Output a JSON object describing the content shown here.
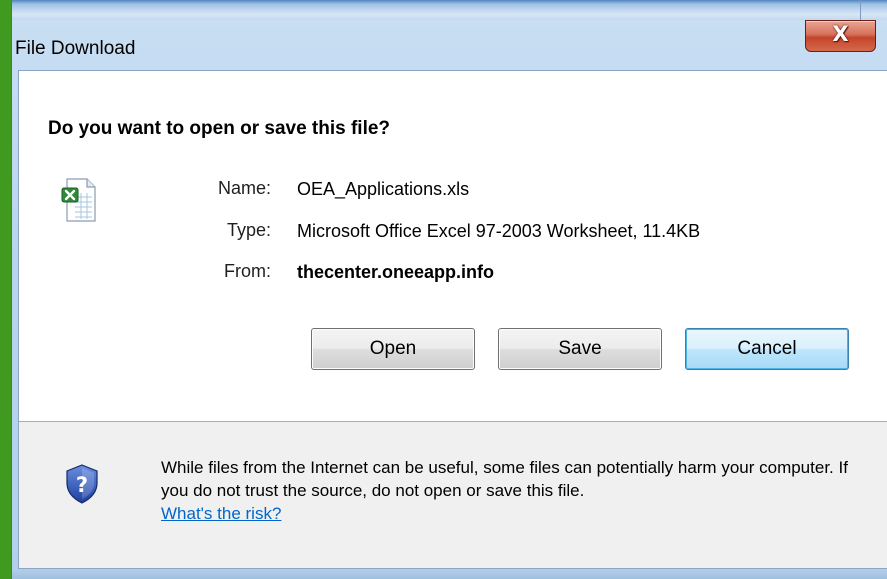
{
  "window": {
    "title": "File Download",
    "close_glyph": "X"
  },
  "dialog": {
    "question": "Do you want to open or save this file?",
    "file_icon": "excel-file-icon",
    "fields": {
      "name_label": "Name:",
      "name_value": "OEA_Applications.xls",
      "type_label": "Type:",
      "type_value": "Microsoft Office Excel 97-2003 Worksheet, 11.4KB",
      "from_label": "From:",
      "from_value": "thecenter.oneeapp.info"
    },
    "buttons": {
      "open": "Open",
      "save": "Save",
      "cancel": "Cancel"
    }
  },
  "footer": {
    "shield_icon": "security-shield-icon",
    "warning_text": "While files from the Internet can be useful, some files can potentially harm your computer. If you do not trust the source, do not open or save this file.",
    "risk_link": "What's the risk?"
  },
  "colors": {
    "background_green": "#3f9a1f",
    "link_blue": "#0066cc",
    "close_red": "#c4442b",
    "default_button_border": "#3c7fb1"
  }
}
